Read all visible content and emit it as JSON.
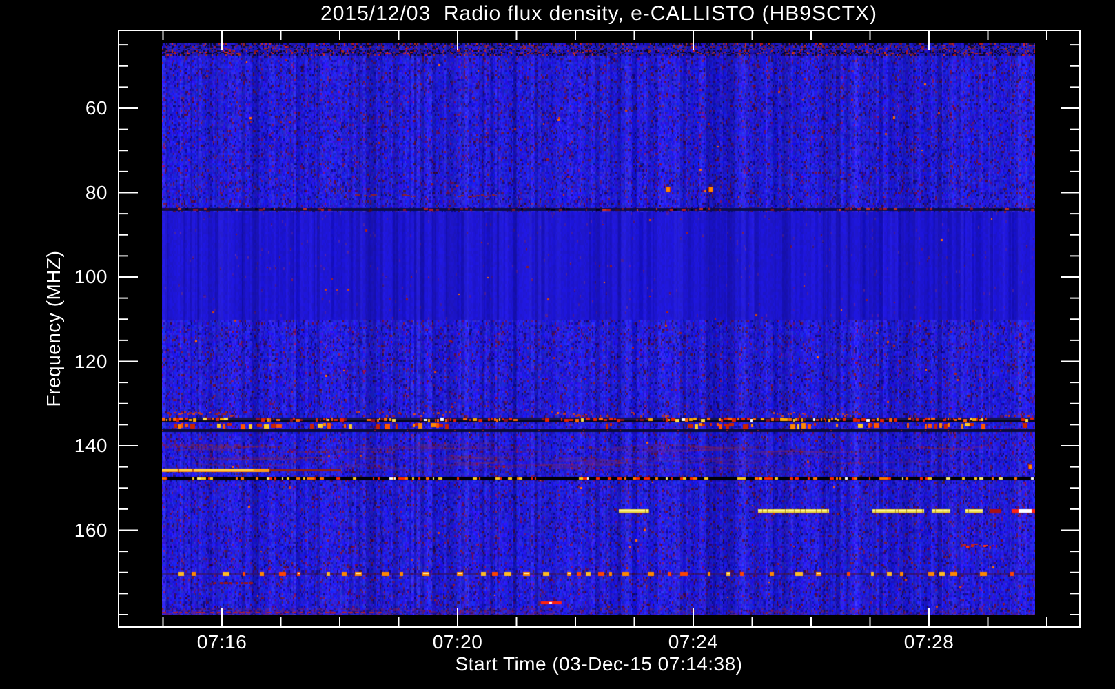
{
  "figure": {
    "background": "#000000",
    "axis_color": "#ffffff",
    "text_color": "#ffffff"
  },
  "chart_data": {
    "type": "heatmap",
    "title": "2015/12/03  Radio flux density, e-CALLISTO (HB9SCTX)",
    "xlabel": "Start Time (03-Dec-15 07:14:38)",
    "ylabel": "Frequency (MHZ)",
    "instrument": "e-CALLISTO (HB9SCTX)",
    "date": "2015/12/03",
    "x_axis": {
      "start_time": "07:14:38",
      "tick_labels": [
        "07:16",
        "07:20",
        "07:24",
        "07:28"
      ],
      "tick_minutes_after_0700": [
        16,
        20,
        24,
        28
      ],
      "minor_tick_every_min": 1,
      "minor_tick_range_min": [
        15,
        30
      ]
    },
    "y_axis": {
      "tick_labels": [
        "60",
        "80",
        "100",
        "120",
        "140",
        "160"
      ],
      "tick_mhz": [
        60,
        80,
        100,
        120,
        140,
        160
      ],
      "minor_tick_every_mhz": 5,
      "range_mhz": [
        45,
        180
      ]
    },
    "colormap": {
      "background_blue": "#2522e8",
      "fm_band_blue": "#2a18f0",
      "speckle_maroon": "#6a1438",
      "hot_scale": [
        "#ff2200",
        "#ff6600",
        "#ffaa00",
        "#ffee55",
        "#ffffff"
      ]
    },
    "features": [
      {
        "kind": "smooth_band",
        "f0": 84.6,
        "f1": 110.2,
        "desc": "FM broadcast band, smooth bright blue with vertical striations"
      },
      {
        "kind": "noise_band",
        "f0": 45.0,
        "f1": 47.6,
        "desc": "dense dark/red RFI speckle band at top edge"
      },
      {
        "kind": "faint_dashes",
        "f": 80.6,
        "segments_u": [
          [
            0.218,
            0.245
          ],
          [
            0.276,
            0.29
          ],
          [
            0.33,
            0.384
          ]
        ],
        "color": "#8a2030",
        "desc": "faint red interference patches near 80 MHz"
      },
      {
        "kind": "pair_dots",
        "f": 78.8,
        "points_u": [
          0.578,
          0.627
        ],
        "color": "#ff8800",
        "desc": "two orange RFI dots near 79 MHz"
      },
      {
        "kind": "dark_dash_line",
        "f": 83.8,
        "desc": "dark channel line with red/black dashes at 84 MHz"
      },
      {
        "kind": "speckle_row",
        "f0": 131.9,
        "f1": 133.2,
        "desc": "scattered red RFI clusters above 132 MHz"
      },
      {
        "kind": "bright_dash_line",
        "f0": 133.3,
        "f1": 134.4,
        "desc": "strong RFI line, dense red/orange/yellow dashes at ~134 MHz"
      },
      {
        "kind": "blob_row",
        "f0": 134.6,
        "f1": 135.9,
        "desc": "red/orange RFI bursts at ~135 MHz"
      },
      {
        "kind": "dark_line",
        "f0": 136.1,
        "f1": 136.7,
        "desc": "dark channel at ~136 MHz"
      },
      {
        "kind": "wisps",
        "f0": 139.0,
        "f1": 146.3,
        "desc": "faint reddish wavy interference wisps 139-146 MHz"
      },
      {
        "kind": "streak",
        "f": 145.7,
        "u0": 0.0,
        "u1": 0.123,
        "u_tail": 0.205,
        "desc": "bright orange streak at ~146 MHz starting at left edge"
      },
      {
        "kind": "black_dash_line",
        "f0": 147.3,
        "f1": 148.2,
        "desc": "saturated black line with bright multicolour dashes at ~148 MHz"
      },
      {
        "kind": "segments_row",
        "f": 155.3,
        "desc": "bright saturated carrier segments at ~155 MHz",
        "segments": [
          {
            "u0": 0.523,
            "u1": 0.558,
            "color": "#eedd44"
          },
          {
            "u0": 0.683,
            "u1": 0.764,
            "color": "#eedd44"
          },
          {
            "u0": 0.814,
            "u1": 0.873,
            "color": "#eedd44"
          },
          {
            "u0": 0.882,
            "u1": 0.903,
            "color": "#eedd44"
          },
          {
            "u0": 0.92,
            "u1": 0.94,
            "color": "#eedd44"
          },
          {
            "u0": 0.948,
            "u1": 0.961,
            "color": "#aa1111"
          },
          {
            "u0": 0.973,
            "u1": 0.981,
            "color": "#ff2211"
          },
          {
            "u0": 0.981,
            "u1": 0.996,
            "color": "#ffffff"
          },
          {
            "u0": 0.996,
            "u1": 1.0,
            "color": "#ff2211"
          }
        ]
      },
      {
        "kind": "red_cluster",
        "f": 163.5,
        "u0": 0.915,
        "u1": 0.959,
        "desc": "red RFI cluster at ~163 MHz near 07:28"
      },
      {
        "kind": "dash_row",
        "f0": 169.8,
        "f1": 170.9,
        "desc": "row of orange/yellow dashes at ~170 MHz across full duration"
      },
      {
        "kind": "dark_red_dash",
        "f": 172.5,
        "u0": 0.059,
        "u1": 0.103,
        "desc": "dark red dashed segment at ~172.5 MHz"
      },
      {
        "kind": "red_dash",
        "f": 177.3,
        "u0": 0.434,
        "u1": 0.458,
        "desc": "short red burst at ~177 MHz near 07:21"
      },
      {
        "kind": "bottom_mottle",
        "f0": 178.6,
        "f1": 180.0,
        "desc": "faint red/purple mottling along bottom edge"
      },
      {
        "kind": "dot",
        "f": 144.6,
        "u": 0.993,
        "color": "#ff8800",
        "desc": "orange dot near right edge at ~145 MHz"
      }
    ]
  }
}
